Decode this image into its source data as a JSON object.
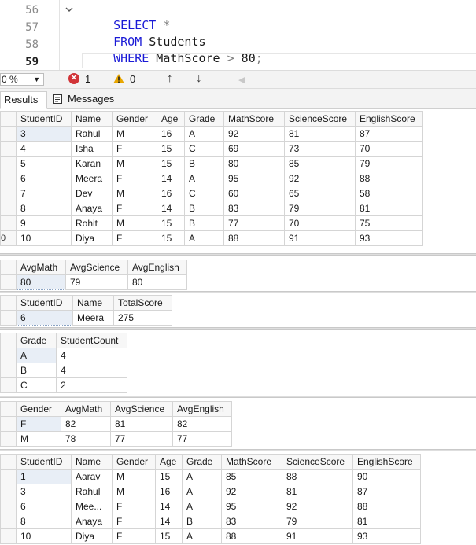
{
  "editor": {
    "lines": [
      {
        "number": "56",
        "tokens": [
          {
            "text": "SELECT",
            "kind": "keyword"
          },
          {
            "text": " *",
            "kind": "operator"
          }
        ]
      },
      {
        "number": "57",
        "tokens": [
          {
            "text": "FROM",
            "kind": "keyword"
          },
          {
            "text": " Students",
            "kind": "plain"
          }
        ]
      },
      {
        "number": "58",
        "tokens": [
          {
            "text": "WHERE",
            "kind": "keyword"
          },
          {
            "text": " MathScore ",
            "kind": "plain"
          },
          {
            "text": ">",
            "kind": "operator"
          },
          {
            "text": " 80",
            "kind": "plain"
          },
          {
            "text": ";",
            "kind": "operator"
          }
        ]
      },
      {
        "number": "59",
        "tokens": []
      }
    ]
  },
  "status_bar": {
    "zoom": "0 %",
    "errors": "1",
    "warnings": "0"
  },
  "tabs": {
    "results_label": "Results",
    "messages_label": "Messages"
  },
  "result_sets": [
    {
      "columns": [
        "StudentID",
        "Name",
        "Gender",
        "Age",
        "Grade",
        "MathScore",
        "ScienceScore",
        "EnglishScore"
      ],
      "widths": [
        70,
        52,
        57,
        35,
        50,
        77,
        90,
        86
      ],
      "row_labels": [
        "",
        "",
        "",
        "",
        "",
        "",
        "",
        "0"
      ],
      "rows": [
        [
          "3",
          "Rahul",
          "M",
          "16",
          "A",
          "92",
          "81",
          "87"
        ],
        [
          "4",
          "Isha",
          "F",
          "15",
          "C",
          "69",
          "73",
          "70"
        ],
        [
          "5",
          "Karan",
          "M",
          "15",
          "B",
          "80",
          "85",
          "79"
        ],
        [
          "6",
          "Meera",
          "F",
          "14",
          "A",
          "95",
          "92",
          "88"
        ],
        [
          "7",
          "Dev",
          "M",
          "16",
          "C",
          "60",
          "65",
          "58"
        ],
        [
          "8",
          "Anaya",
          "F",
          "14",
          "B",
          "83",
          "79",
          "81"
        ],
        [
          "9",
          "Rohit",
          "M",
          "15",
          "B",
          "77",
          "70",
          "75"
        ],
        [
          "10",
          "Diya",
          "F",
          "15",
          "A",
          "88",
          "91",
          "93"
        ]
      ]
    },
    {
      "columns": [
        "AvgMath",
        "AvgScience",
        "AvgEnglish"
      ],
      "widths": [
        63,
        79,
        75
      ],
      "row_labels": [
        ""
      ],
      "rows": [
        [
          "80",
          "79",
          "80"
        ]
      ]
    },
    {
      "columns": [
        "StudentID",
        "Name",
        "TotalScore"
      ],
      "widths": [
        72,
        52,
        74
      ],
      "row_labels": [
        ""
      ],
      "rows": [
        [
          "6",
          "Meera",
          "275"
        ]
      ]
    },
    {
      "columns": [
        "Grade",
        "StudentCount"
      ],
      "widths": [
        51,
        90
      ],
      "row_labels": [
        "",
        "",
        ""
      ],
      "rows": [
        [
          "A",
          "4"
        ],
        [
          "B",
          "4"
        ],
        [
          "C",
          "2"
        ]
      ]
    },
    {
      "columns": [
        "Gender",
        "AvgMath",
        "AvgScience",
        "AvgEnglish"
      ],
      "widths": [
        57,
        63,
        79,
        75
      ],
      "row_labels": [
        "",
        ""
      ],
      "rows": [
        [
          "F",
          "82",
          "81",
          "82"
        ],
        [
          "M",
          "78",
          "77",
          "77"
        ]
      ]
    },
    {
      "columns": [
        "StudentID",
        "Name",
        "Gender",
        "Age",
        "Grade",
        "MathScore",
        "ScienceScore",
        "EnglishScore"
      ],
      "widths": [
        70,
        52,
        55,
        34,
        50,
        77,
        90,
        86
      ],
      "row_labels": [
        "",
        "",
        "",
        "",
        ""
      ],
      "rows": [
        [
          "1",
          "Aarav",
          "M",
          "15",
          "A",
          "85",
          "88",
          "90"
        ],
        [
          "3",
          "Rahul",
          "M",
          "16",
          "A",
          "92",
          "81",
          "87"
        ],
        [
          "6",
          "Mee...",
          "F",
          "14",
          "A",
          "95",
          "92",
          "88"
        ],
        [
          "8",
          "Anaya",
          "F",
          "14",
          "B",
          "83",
          "79",
          "81"
        ],
        [
          "10",
          "Diya",
          "F",
          "15",
          "A",
          "88",
          "91",
          "93"
        ]
      ]
    }
  ]
}
